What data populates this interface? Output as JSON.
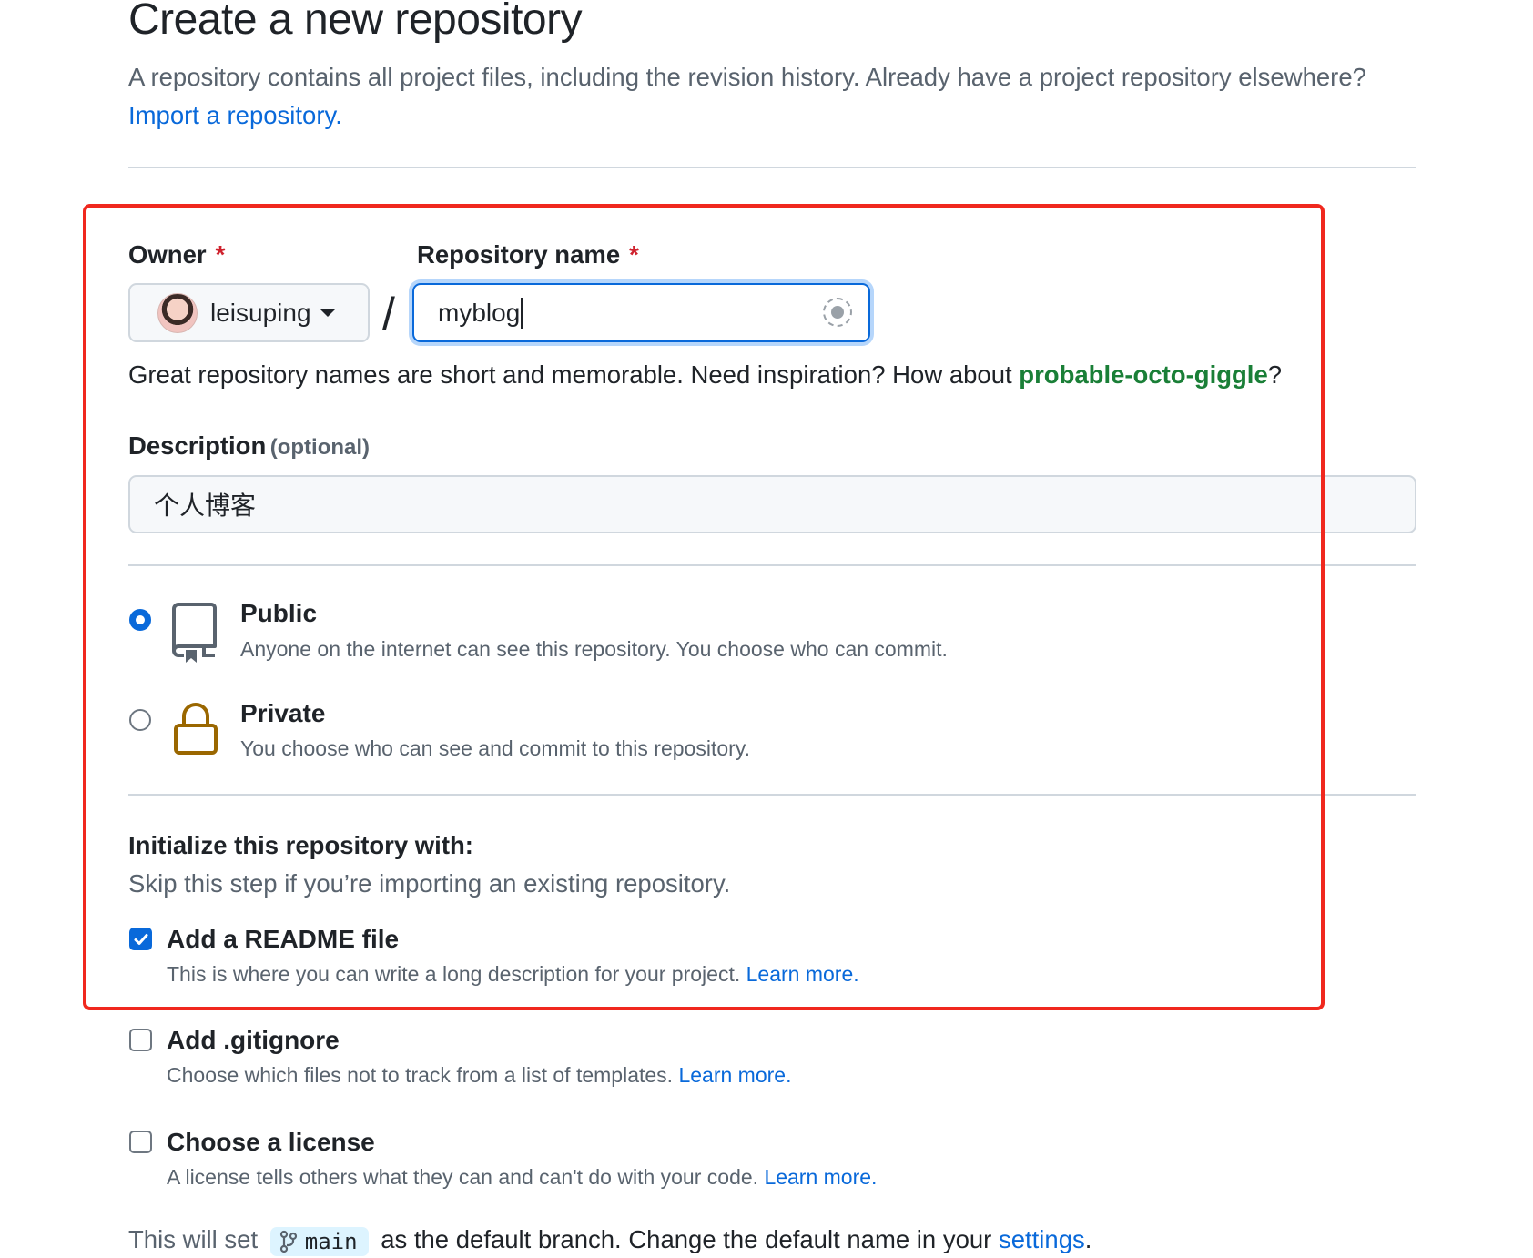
{
  "page": {
    "title": "Create a new repository",
    "intro": "A repository contains all project files, including the revision history. Already have a project repository elsewhere?",
    "import_link": "Import a repository."
  },
  "owner": {
    "label": "Owner",
    "required_mark": "*",
    "value": "leisuping"
  },
  "separator": "/",
  "repo_name": {
    "label": "Repository name",
    "required_mark": "*",
    "value": "myblog",
    "availability_icon": "loading-spinner-icon"
  },
  "name_hint": {
    "text": "Great repository names are short and memorable. Need inspiration? How about",
    "suggestion": "probable-octo-giggle",
    "suffix": "?"
  },
  "description": {
    "label": "Description",
    "optional": "(optional)",
    "value": "个人博客"
  },
  "visibility": {
    "public": {
      "title": "Public",
      "desc": "Anyone on the internet can see this repository. You choose who can commit.",
      "checked": true,
      "icon": "repo-icon"
    },
    "private": {
      "title": "Private",
      "desc": "You choose who can see and commit to this repository.",
      "checked": false,
      "icon": "lock-icon"
    }
  },
  "init": {
    "title": "Initialize this repository with:",
    "subtitle": "Skip this step if you’re importing an existing repository.",
    "readme": {
      "label": "Add a README file",
      "desc": "This is where you can write a long description for your project.",
      "link": "Learn more.",
      "checked": true
    },
    "gitignore": {
      "label": "Add .gitignore",
      "desc": "Choose which files not to track from a list of templates.",
      "link": "Learn more.",
      "checked": false
    },
    "license": {
      "label": "Choose a license",
      "desc": "A license tells others what they can and can't do with your code.",
      "link": "Learn more.",
      "checked": false
    }
  },
  "branch_note": {
    "prefix": "This will set",
    "branch": "main",
    "middle": "as the default branch. Change the default name in your",
    "link": "settings",
    "suffix": "."
  },
  "colors": {
    "accent": "#0969da",
    "highlight_box": "#f0281e",
    "suggestion": "#1a7f37",
    "lock_icon": "#9a6700",
    "required": "#cf222e"
  }
}
